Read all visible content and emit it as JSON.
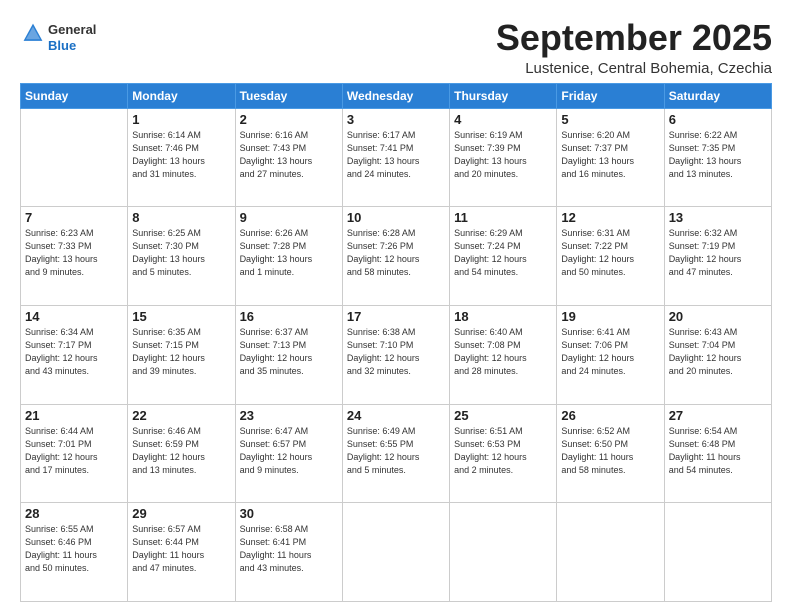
{
  "header": {
    "logo_general": "General",
    "logo_blue": "Blue",
    "month": "September 2025",
    "location": "Lustenice, Central Bohemia, Czechia"
  },
  "weekdays": [
    "Sunday",
    "Monday",
    "Tuesday",
    "Wednesday",
    "Thursday",
    "Friday",
    "Saturday"
  ],
  "weeks": [
    [
      {
        "day": "",
        "info": ""
      },
      {
        "day": "1",
        "info": "Sunrise: 6:14 AM\nSunset: 7:46 PM\nDaylight: 13 hours\nand 31 minutes."
      },
      {
        "day": "2",
        "info": "Sunrise: 6:16 AM\nSunset: 7:43 PM\nDaylight: 13 hours\nand 27 minutes."
      },
      {
        "day": "3",
        "info": "Sunrise: 6:17 AM\nSunset: 7:41 PM\nDaylight: 13 hours\nand 24 minutes."
      },
      {
        "day": "4",
        "info": "Sunrise: 6:19 AM\nSunset: 7:39 PM\nDaylight: 13 hours\nand 20 minutes."
      },
      {
        "day": "5",
        "info": "Sunrise: 6:20 AM\nSunset: 7:37 PM\nDaylight: 13 hours\nand 16 minutes."
      },
      {
        "day": "6",
        "info": "Sunrise: 6:22 AM\nSunset: 7:35 PM\nDaylight: 13 hours\nand 13 minutes."
      }
    ],
    [
      {
        "day": "7",
        "info": "Sunrise: 6:23 AM\nSunset: 7:33 PM\nDaylight: 13 hours\nand 9 minutes."
      },
      {
        "day": "8",
        "info": "Sunrise: 6:25 AM\nSunset: 7:30 PM\nDaylight: 13 hours\nand 5 minutes."
      },
      {
        "day": "9",
        "info": "Sunrise: 6:26 AM\nSunset: 7:28 PM\nDaylight: 13 hours\nand 1 minute."
      },
      {
        "day": "10",
        "info": "Sunrise: 6:28 AM\nSunset: 7:26 PM\nDaylight: 12 hours\nand 58 minutes."
      },
      {
        "day": "11",
        "info": "Sunrise: 6:29 AM\nSunset: 7:24 PM\nDaylight: 12 hours\nand 54 minutes."
      },
      {
        "day": "12",
        "info": "Sunrise: 6:31 AM\nSunset: 7:22 PM\nDaylight: 12 hours\nand 50 minutes."
      },
      {
        "day": "13",
        "info": "Sunrise: 6:32 AM\nSunset: 7:19 PM\nDaylight: 12 hours\nand 47 minutes."
      }
    ],
    [
      {
        "day": "14",
        "info": "Sunrise: 6:34 AM\nSunset: 7:17 PM\nDaylight: 12 hours\nand 43 minutes."
      },
      {
        "day": "15",
        "info": "Sunrise: 6:35 AM\nSunset: 7:15 PM\nDaylight: 12 hours\nand 39 minutes."
      },
      {
        "day": "16",
        "info": "Sunrise: 6:37 AM\nSunset: 7:13 PM\nDaylight: 12 hours\nand 35 minutes."
      },
      {
        "day": "17",
        "info": "Sunrise: 6:38 AM\nSunset: 7:10 PM\nDaylight: 12 hours\nand 32 minutes."
      },
      {
        "day": "18",
        "info": "Sunrise: 6:40 AM\nSunset: 7:08 PM\nDaylight: 12 hours\nand 28 minutes."
      },
      {
        "day": "19",
        "info": "Sunrise: 6:41 AM\nSunset: 7:06 PM\nDaylight: 12 hours\nand 24 minutes."
      },
      {
        "day": "20",
        "info": "Sunrise: 6:43 AM\nSunset: 7:04 PM\nDaylight: 12 hours\nand 20 minutes."
      }
    ],
    [
      {
        "day": "21",
        "info": "Sunrise: 6:44 AM\nSunset: 7:01 PM\nDaylight: 12 hours\nand 17 minutes."
      },
      {
        "day": "22",
        "info": "Sunrise: 6:46 AM\nSunset: 6:59 PM\nDaylight: 12 hours\nand 13 minutes."
      },
      {
        "day": "23",
        "info": "Sunrise: 6:47 AM\nSunset: 6:57 PM\nDaylight: 12 hours\nand 9 minutes."
      },
      {
        "day": "24",
        "info": "Sunrise: 6:49 AM\nSunset: 6:55 PM\nDaylight: 12 hours\nand 5 minutes."
      },
      {
        "day": "25",
        "info": "Sunrise: 6:51 AM\nSunset: 6:53 PM\nDaylight: 12 hours\nand 2 minutes."
      },
      {
        "day": "26",
        "info": "Sunrise: 6:52 AM\nSunset: 6:50 PM\nDaylight: 11 hours\nand 58 minutes."
      },
      {
        "day": "27",
        "info": "Sunrise: 6:54 AM\nSunset: 6:48 PM\nDaylight: 11 hours\nand 54 minutes."
      }
    ],
    [
      {
        "day": "28",
        "info": "Sunrise: 6:55 AM\nSunset: 6:46 PM\nDaylight: 11 hours\nand 50 minutes."
      },
      {
        "day": "29",
        "info": "Sunrise: 6:57 AM\nSunset: 6:44 PM\nDaylight: 11 hours\nand 47 minutes."
      },
      {
        "day": "30",
        "info": "Sunrise: 6:58 AM\nSunset: 6:41 PM\nDaylight: 11 hours\nand 43 minutes."
      },
      {
        "day": "",
        "info": ""
      },
      {
        "day": "",
        "info": ""
      },
      {
        "day": "",
        "info": ""
      },
      {
        "day": "",
        "info": ""
      }
    ]
  ]
}
